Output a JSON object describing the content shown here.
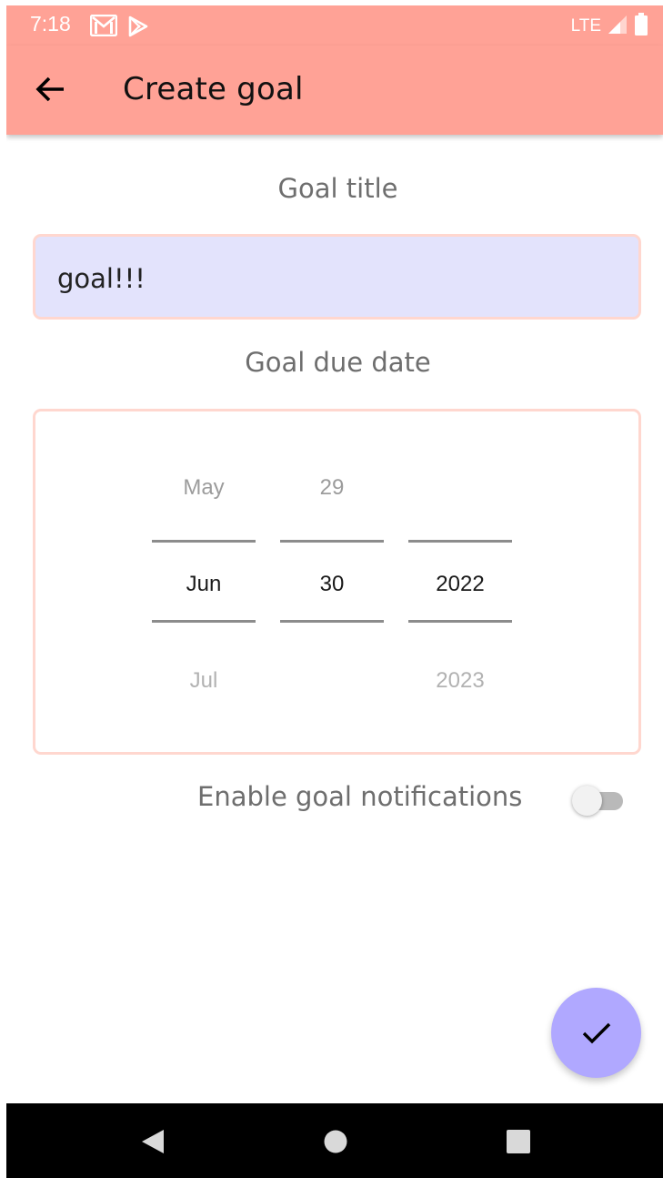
{
  "status_bar": {
    "time": "7:18",
    "icons": [
      "gmail-icon",
      "play-store-icon"
    ],
    "network": "LTE",
    "right_icons": [
      "signal-icon",
      "battery-icon"
    ]
  },
  "app_bar": {
    "title": "Create goal",
    "back_icon": "arrow-back-icon",
    "color": "#ffa296"
  },
  "form": {
    "goal_title_label": "Goal title",
    "goal_title_value": "goal!!!",
    "due_date_label": "Goal due date",
    "date_picker": {
      "month": {
        "prev": "May",
        "current": "Jun",
        "next": "Jul"
      },
      "day": {
        "prev": "29",
        "current": "30",
        "next": ""
      },
      "year": {
        "prev": "",
        "current": "2022",
        "next": "2023"
      }
    },
    "notifications_label": "Enable goal notifications",
    "notifications_enabled": false
  },
  "fab": {
    "icon": "check-icon",
    "color": "#b0a8ff"
  },
  "nav_bar": {
    "icons": [
      "nav-back-icon",
      "nav-home-icon",
      "nav-recents-icon"
    ]
  }
}
